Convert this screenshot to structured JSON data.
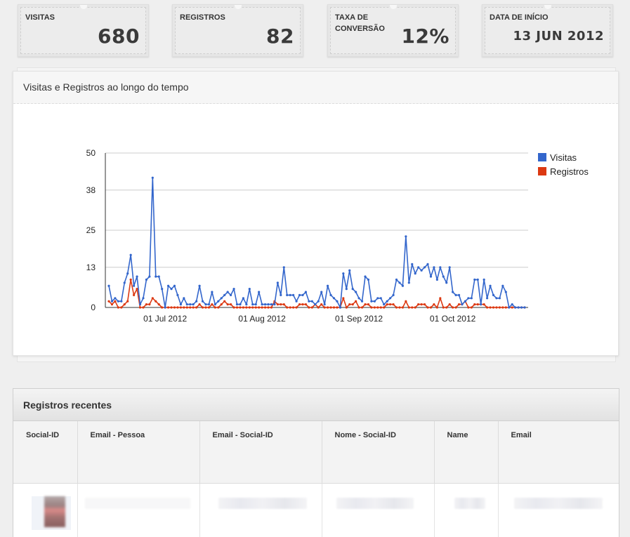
{
  "stats": [
    {
      "label": "VISITAS",
      "value": "680"
    },
    {
      "label": "REGISTROS",
      "value": "82"
    },
    {
      "label": "TAXA DE CONVERSÃO",
      "value": "12%"
    },
    {
      "label": "DATA DE INÍCIO",
      "value": "13 JUN 2012"
    }
  ],
  "chart_panel": {
    "title": "Visitas e Registros ao longo do tempo"
  },
  "chart_data": {
    "type": "line",
    "title": "",
    "xlabel": "",
    "ylabel": "",
    "x_start": "2012-06-13",
    "x_ticks": [
      "01 Jul 2012",
      "01 Aug 2012",
      "01 Sep 2012",
      "01 Oct 2012"
    ],
    "y_ticks": [
      "0",
      "13",
      "25",
      "38",
      "50"
    ],
    "ylim": [
      0,
      50
    ],
    "grid": true,
    "legend_position": "right",
    "series": [
      {
        "name": "Visitas",
        "color": "#3366cc",
        "values": [
          7,
          2,
          3,
          2,
          2,
          8,
          11,
          17,
          7,
          10,
          1,
          3,
          9,
          10,
          42,
          10,
          10,
          6,
          0,
          7,
          6,
          7,
          4,
          1,
          3,
          1,
          1,
          1,
          2,
          7,
          2,
          1,
          1,
          5,
          1,
          2,
          3,
          4,
          5,
          4,
          6,
          1,
          1,
          3,
          1,
          6,
          1,
          1,
          5,
          1,
          1,
          1,
          1,
          1,
          8,
          4,
          13,
          4,
          4,
          4,
          2,
          4,
          4,
          5,
          2,
          2,
          1,
          2,
          5,
          1,
          7,
          4,
          3,
          2,
          0,
          11,
          6,
          12,
          6,
          5,
          3,
          2,
          10,
          9,
          2,
          2,
          3,
          3,
          1,
          2,
          3,
          4,
          9,
          8,
          7,
          23,
          8,
          14,
          11,
          13,
          12,
          13,
          14,
          10,
          13,
          9,
          13,
          10,
          8,
          13,
          5,
          4,
          4,
          1,
          2,
          3,
          3,
          9,
          9,
          1,
          9,
          3,
          7,
          4,
          3,
          3,
          7,
          5,
          0,
          1,
          0,
          0,
          0,
          0
        ],
        "values_length": 134
      },
      {
        "name": "Registros",
        "color": "#dc3912",
        "values": [
          2,
          1,
          2,
          0,
          0,
          1,
          2,
          9,
          4,
          6,
          0,
          0,
          1,
          1,
          3,
          2,
          1,
          0,
          0,
          0,
          0,
          0,
          0,
          0,
          0,
          0,
          0,
          0,
          0,
          1,
          0,
          0,
          0,
          1,
          0,
          0,
          1,
          2,
          1,
          1,
          0,
          0,
          0,
          0,
          0,
          0,
          0,
          0,
          0,
          0,
          0,
          0,
          0,
          2,
          1,
          1,
          1,
          0,
          0,
          0,
          0,
          1,
          1,
          1,
          0,
          0,
          1,
          0,
          1,
          0,
          0,
          0,
          0,
          0,
          0,
          3,
          0,
          1,
          1,
          2,
          0,
          0,
          1,
          1,
          0,
          0,
          0,
          0,
          0,
          1,
          1,
          1,
          0,
          0,
          0,
          2,
          0,
          0,
          0,
          1,
          1,
          1,
          0,
          0,
          1,
          0,
          3,
          0,
          0,
          1,
          0,
          0,
          1,
          1,
          2,
          0,
          0,
          1,
          1,
          1,
          1,
          0,
          0,
          0,
          0,
          0,
          0,
          0,
          0,
          0,
          0,
          0,
          0,
          0
        ],
        "values_length": 134
      }
    ]
  },
  "table": {
    "title": "Registros recentes",
    "columns": [
      "Social-ID",
      "Email - Pessoa",
      "Email - Social-ID",
      "Nome - Social-ID",
      "Name",
      "Email"
    ]
  },
  "colors": {
    "visitas": "#3366cc",
    "registros": "#dc3912",
    "grid": "#cccccc"
  }
}
